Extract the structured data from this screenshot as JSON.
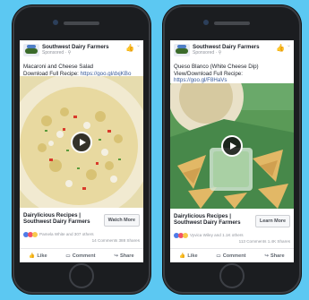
{
  "colors": {
    "background": "#5cc8f2",
    "link": "#365899"
  },
  "phones": [
    {
      "page_name": "Southwest Dairy Farmers",
      "sponsored": "Sponsored · ⚲",
      "post_line1": "Macaroni and Cheese Salad",
      "post_line2_prefix": "Download Full Recipe: ",
      "post_link": "https://goo.gl/dxjKBo",
      "cta_title_l1": "Dairylicious Recipes |",
      "cta_title_l2": "Southwest Dairy Farmers",
      "cta_button": "Watch More",
      "reactions_names": "Pamela White and 307 others",
      "counts": "14 Comments   388 Shares",
      "actions": [
        "Like",
        "Comment",
        "Share"
      ]
    },
    {
      "page_name": "Southwest Dairy Farmers",
      "sponsored": "Sponsored · ⚲",
      "post_line1": "Queso Blanco (White Cheese Dip)",
      "post_line2_prefix": "View/Download Full Recipe:",
      "post_link": "https://goo.gl/F8HaVs",
      "cta_title_l1": "Dairylicious Recipes |",
      "cta_title_l2": "Southwest Dairy Farmers",
      "cta_button": "Learn More",
      "reactions_names": "Vyvica Wiley and 1.1K others",
      "counts": "113 Comments   1.4K Shares",
      "actions": [
        "Like",
        "Comment",
        "Share"
      ]
    }
  ],
  "icons": [
    "thumbs-up-icon",
    "play-icon",
    "comment-icon",
    "share-icon",
    "chevron-down-icon"
  ]
}
